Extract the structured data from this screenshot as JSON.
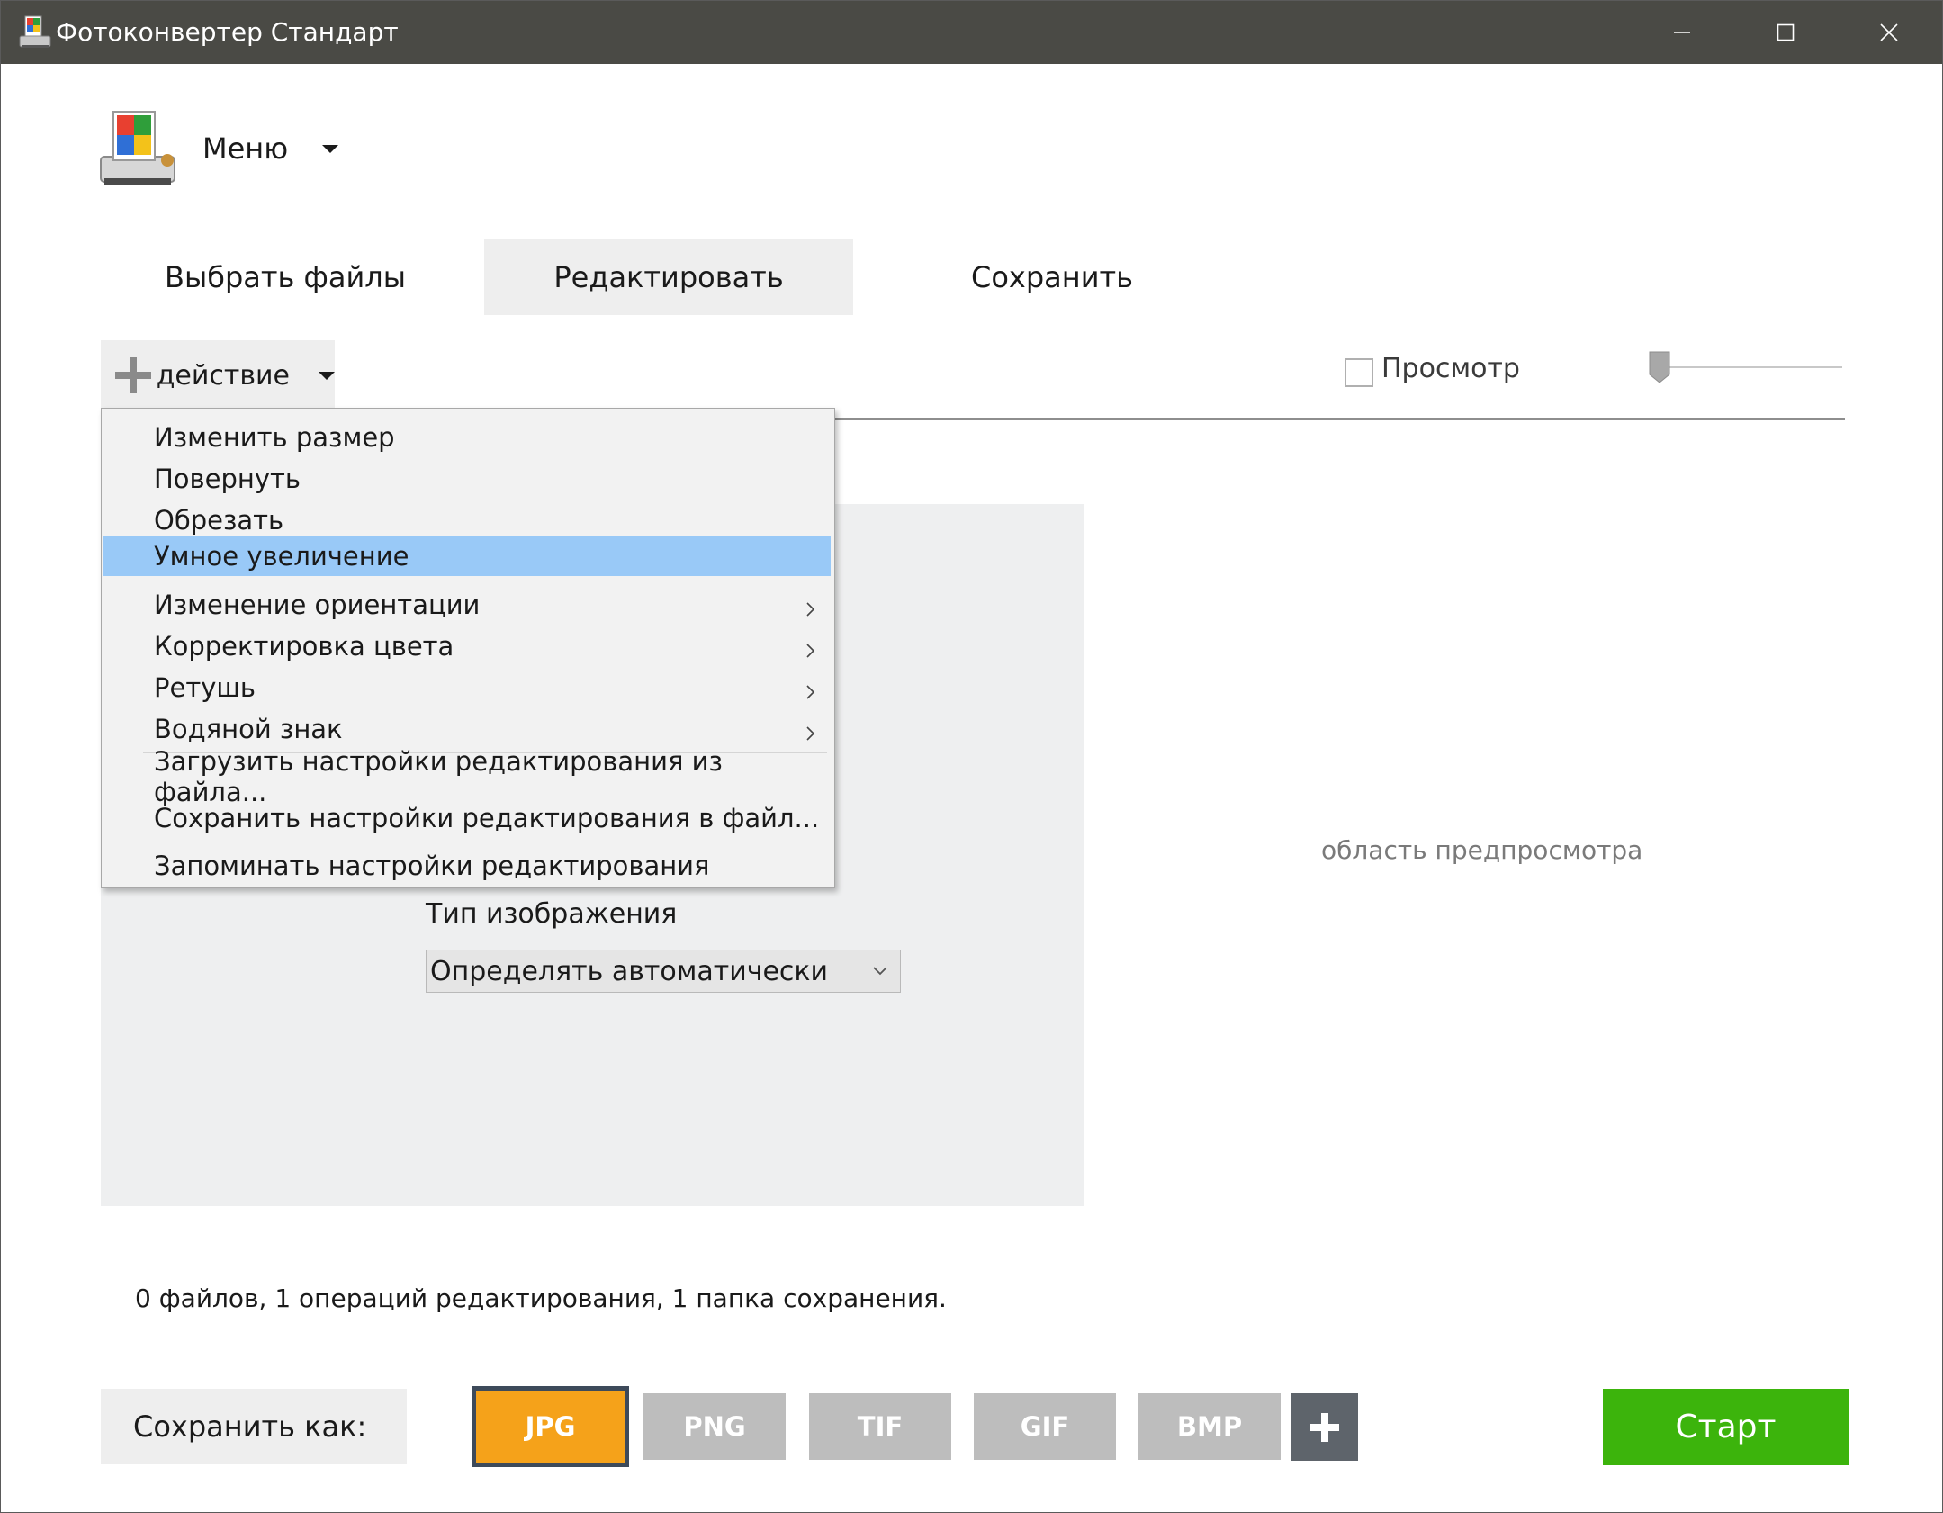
{
  "window": {
    "title": "Фотоконвертер Стандарт"
  },
  "app_menu": {
    "label": "Меню"
  },
  "tabs": [
    {
      "label": "Выбрать файлы"
    },
    {
      "label": "Редактировать"
    },
    {
      "label": "Сохранить"
    }
  ],
  "toolbar": {
    "action_label": "действие",
    "preview_label": "Просмотр",
    "preview_checked": false
  },
  "menu": {
    "items": [
      {
        "label": "Изменить размер"
      },
      {
        "label": "Повернуть"
      },
      {
        "label": "Обрезать"
      },
      {
        "label": "Умное увеличение",
        "highlighted": true
      },
      {
        "label": "Изменение ориентации",
        "submenu": true
      },
      {
        "label": "Корректировка цвета",
        "submenu": true
      },
      {
        "label": "Ретушь",
        "submenu": true
      },
      {
        "label": "Водяной знак",
        "submenu": true
      },
      {
        "label": "Загрузить настройки редактирования из файла..."
      },
      {
        "label": "Сохранить настройки редактирования в файл..."
      },
      {
        "label": "Запоминать настройки редактирования"
      }
    ]
  },
  "panel": {
    "image_type_label": "Тип изображения",
    "image_type_value": "Определять автоматически"
  },
  "preview": {
    "placeholder": "область предпросмотра"
  },
  "status": {
    "text": "0 файлов, 1 операций редактирования, 1 папка сохранения."
  },
  "bottom": {
    "save_as_label": "Сохранить как:",
    "formats": [
      "JPG",
      "PNG",
      "TIF",
      "GIF",
      "BMP"
    ],
    "selected_format": "JPG",
    "start_label": "Старт"
  },
  "colors": {
    "titlebar": "#4a4a45",
    "accent_selected_format": "#f5a21a",
    "start_button": "#3cb40c",
    "menu_highlight": "#99c9f7"
  }
}
